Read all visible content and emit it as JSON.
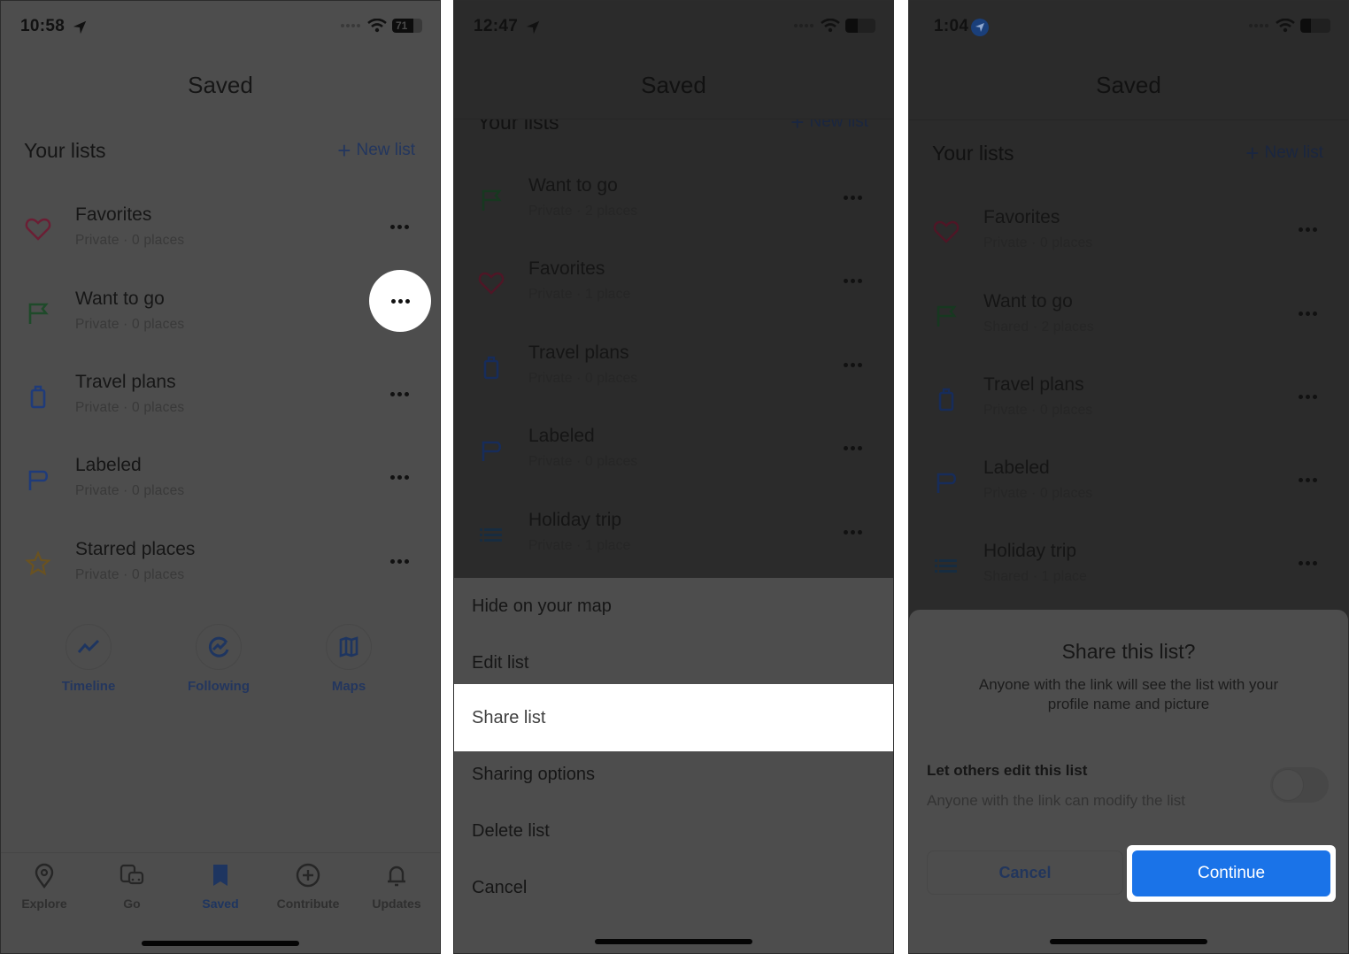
{
  "colors": {
    "accent_blue": "#1a73e8",
    "dim_link": "#23365e",
    "heart": "#6b1e34",
    "flag": "#1f4a2a",
    "suitcase": "#1f3b7a",
    "label": "#1f3b7a",
    "star": "#6a5220",
    "list": "#1f3b5a"
  },
  "panel1": {
    "status": {
      "time": "10:58",
      "battery": "71"
    },
    "title": "Saved",
    "lists_header": "Your lists",
    "new_list": "New list",
    "items": [
      {
        "name": "Favorites",
        "meta": "Private · 0 places",
        "icon": "heart-icon"
      },
      {
        "name": "Want to go",
        "meta": "Private · 0 places",
        "icon": "flag-icon"
      },
      {
        "name": "Travel plans",
        "meta": "Private · 0 places",
        "icon": "suitcase-icon"
      },
      {
        "name": "Labeled",
        "meta": "Private · 0 places",
        "icon": "label-flag-icon"
      },
      {
        "name": "Starred places",
        "meta": "Private · 0 places",
        "icon": "star-icon"
      }
    ],
    "shortcuts": [
      {
        "label": "Timeline",
        "icon": "timeline-icon"
      },
      {
        "label": "Following",
        "icon": "following-icon"
      },
      {
        "label": "Maps",
        "icon": "map-icon"
      }
    ],
    "nav": [
      {
        "label": "Explore",
        "icon": "pin-icon",
        "active": false
      },
      {
        "label": "Go",
        "icon": "transit-icon",
        "active": false
      },
      {
        "label": "Saved",
        "icon": "bookmark-icon",
        "active": true
      },
      {
        "label": "Contribute",
        "icon": "add-circle-icon",
        "active": false
      },
      {
        "label": "Updates",
        "icon": "bell-icon",
        "active": false
      }
    ]
  },
  "panel2": {
    "status": {
      "time": "12:47"
    },
    "title": "Saved",
    "lists_header": "Your lists",
    "new_list": "New list",
    "items": [
      {
        "name": "Want to go",
        "meta": "Private · 2 places",
        "icon": "flag-icon"
      },
      {
        "name": "Favorites",
        "meta": "Private · 1 place",
        "icon": "heart-icon"
      },
      {
        "name": "Travel plans",
        "meta": "Private · 0 places",
        "icon": "suitcase-icon"
      },
      {
        "name": "Labeled",
        "meta": "Private · 0 places",
        "icon": "label-flag-icon"
      },
      {
        "name": "Holiday trip",
        "meta": "Private · 1 place",
        "icon": "list-icon"
      }
    ],
    "sheet": [
      {
        "label": "Hide on your map",
        "highlighted": false
      },
      {
        "label": "Edit list",
        "highlighted": false
      },
      {
        "label": "Share list",
        "highlighted": true
      },
      {
        "label": "Sharing options",
        "highlighted": false
      },
      {
        "label": "Delete list",
        "highlighted": false
      },
      {
        "label": "Cancel",
        "highlighted": false
      }
    ]
  },
  "panel3": {
    "status": {
      "time": "1:04"
    },
    "title": "Saved",
    "lists_header": "Your lists",
    "new_list": "New list",
    "items": [
      {
        "name": "Favorites",
        "meta": "Private · 0 places",
        "icon": "heart-icon"
      },
      {
        "name": "Want to go",
        "meta": "Shared · 2 places",
        "icon": "flag-icon"
      },
      {
        "name": "Travel plans",
        "meta": "Private · 0 places",
        "icon": "suitcase-icon"
      },
      {
        "name": "Labeled",
        "meta": "Private · 0 places",
        "icon": "label-flag-icon"
      },
      {
        "name": "Holiday trip",
        "meta": "Shared · 1 place",
        "icon": "list-icon"
      }
    ],
    "dialog": {
      "title": "Share this list?",
      "body": "Anyone with the link will see the list with your profile name and picture",
      "toggle_label": "Let others edit this list",
      "toggle_sub": "Anyone with the link can modify the list",
      "toggle_on": false,
      "cancel": "Cancel",
      "continue": "Continue"
    }
  }
}
